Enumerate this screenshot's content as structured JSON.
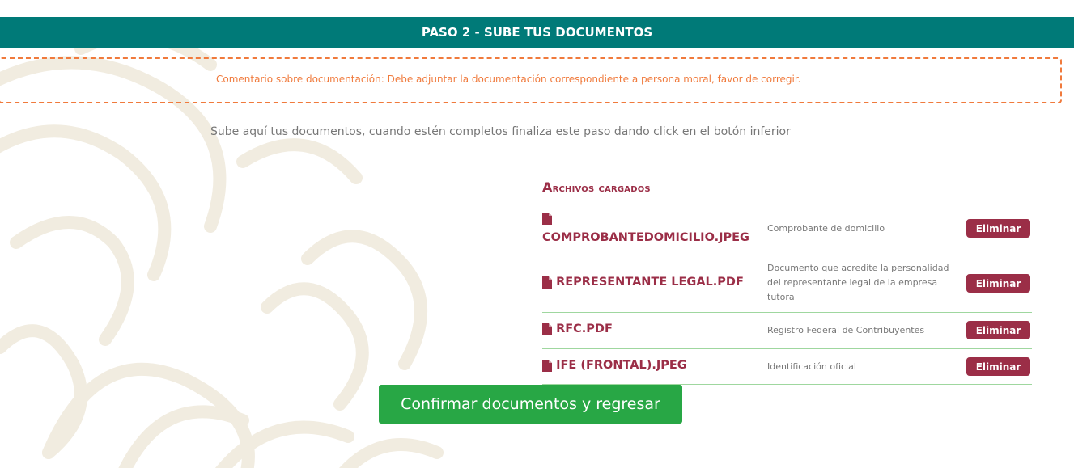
{
  "header": {
    "title": "PASO 2 - SUBE TUS DOCUMENTOS"
  },
  "comment": {
    "text": "Comentario sobre documentación: Debe adjuntar la documentación correspondiente a persona moral, favor de corregir."
  },
  "intro": {
    "text": "Sube aquí tus documentos, cuando estén completos finaliza este paso dando click en el botón inferior"
  },
  "files": {
    "title_first": "A",
    "title_rest": "rchivos cargados",
    "items": [
      {
        "name": "COMPROBANTEDOMICILIO.JPEG",
        "description": "Comprobante de domicilio",
        "action": "Eliminar"
      },
      {
        "name": "REPRESENTANTE LEGAL.PDF",
        "description": "Documento que acredite la personalidad del representante legal de la empresa tutora",
        "action": "Eliminar"
      },
      {
        "name": "RFC.PDF",
        "description": "Registro Federal de Contribuyentes",
        "action": "Eliminar"
      },
      {
        "name": "IFE (FRONTAL).JPEG",
        "description": "Identificación oficial",
        "action": "Eliminar"
      }
    ]
  },
  "confirm_button": {
    "label": "Confirmar documentos y regresar"
  },
  "colors": {
    "header": "#007a78",
    "comment": "#f07a3c",
    "accent": "#9b2e47",
    "confirm": "#28a745"
  }
}
